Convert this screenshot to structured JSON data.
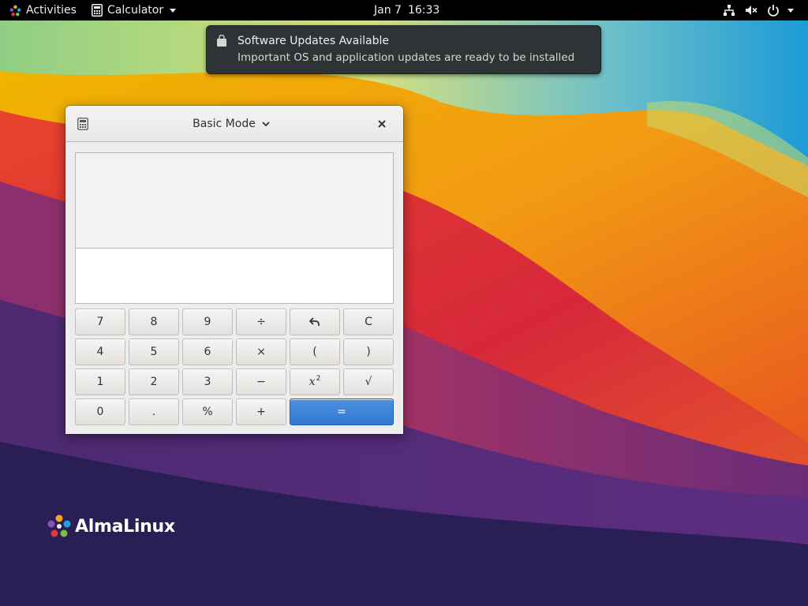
{
  "topbar": {
    "activities_label": "Activities",
    "app_menu_label": "Calculator",
    "clock_date": "Jan 7",
    "clock_time": "16:33"
  },
  "notification": {
    "title": "Software Updates Available",
    "body": "Important OS and application updates are ready to be installed",
    "icon": "shopping-bag-icon"
  },
  "calculator": {
    "mode_label": "Basic Mode",
    "history_text": "",
    "entry_text": "",
    "keypad": {
      "row1": [
        "7",
        "8",
        "9",
        "÷",
        "↶",
        "C"
      ],
      "row2": [
        "4",
        "5",
        "6",
        "×",
        "(",
        ")"
      ],
      "row3": [
        "1",
        "2",
        "3",
        "−",
        "x",
        "√"
      ],
      "row3_superscript": "2",
      "row4": [
        "0",
        ".",
        "%",
        "+",
        "="
      ]
    },
    "accent_color": "#3584e4"
  },
  "branding": {
    "text": "AlmaLinux"
  },
  "icons": [
    "almalinux-logo-icon",
    "calculator-icon",
    "caret-down-icon",
    "network-icon",
    "volume-muted-icon",
    "power-icon",
    "shopping-bag-icon",
    "chevron-down-icon",
    "close-icon",
    "undo-icon"
  ]
}
